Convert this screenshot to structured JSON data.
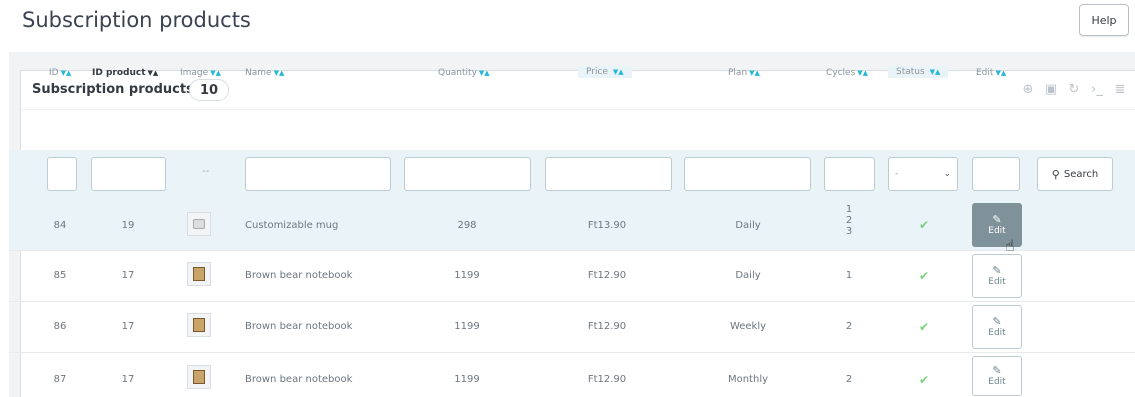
{
  "page": {
    "title": "Subscription products",
    "help_label": "Help"
  },
  "panel": {
    "title": "Subscription products",
    "count": "10",
    "toolbar_icons": [
      "add-icon",
      "export-icon",
      "refresh-icon",
      "sql-query-icon",
      "database-icon"
    ]
  },
  "columns": {
    "id": "ID",
    "id_product": "ID product",
    "image": "Image",
    "name": "Name",
    "quantity": "Quantity",
    "price": "Price",
    "plan": "Plan",
    "cycles": "Cycles",
    "status": "Status",
    "edit": "Edit",
    "sort_arrows": "▼▲"
  },
  "filters": {
    "image_placeholder": "--",
    "status_value": "-",
    "search_label": "Search"
  },
  "rows": [
    {
      "id": "84",
      "id_product": "19",
      "name": "Customizable mug",
      "quantity": "298",
      "price": "Ft13.90",
      "plan": "Daily",
      "cycles": [
        "1",
        "2",
        "3"
      ],
      "edit": "Edit"
    },
    {
      "id": "85",
      "id_product": "17",
      "name": "Brown bear notebook",
      "quantity": "1199",
      "price": "Ft12.90",
      "plan": "Daily",
      "cycles": [
        "1"
      ],
      "edit": "Edit"
    },
    {
      "id": "86",
      "id_product": "17",
      "name": "Brown bear notebook",
      "quantity": "1199",
      "price": "Ft12.90",
      "plan": "Weekly",
      "cycles": [
        "2"
      ],
      "edit": "Edit"
    },
    {
      "id": "87",
      "id_product": "17",
      "name": "Brown bear notebook",
      "quantity": "1199",
      "price": "Ft12.90",
      "plan": "Monthly",
      "cycles": [
        "2"
      ],
      "edit": "Edit"
    }
  ],
  "colors": {
    "accent": "#25b9d7",
    "status_ok": "#78d07d",
    "edit_active": "#7f9199"
  }
}
